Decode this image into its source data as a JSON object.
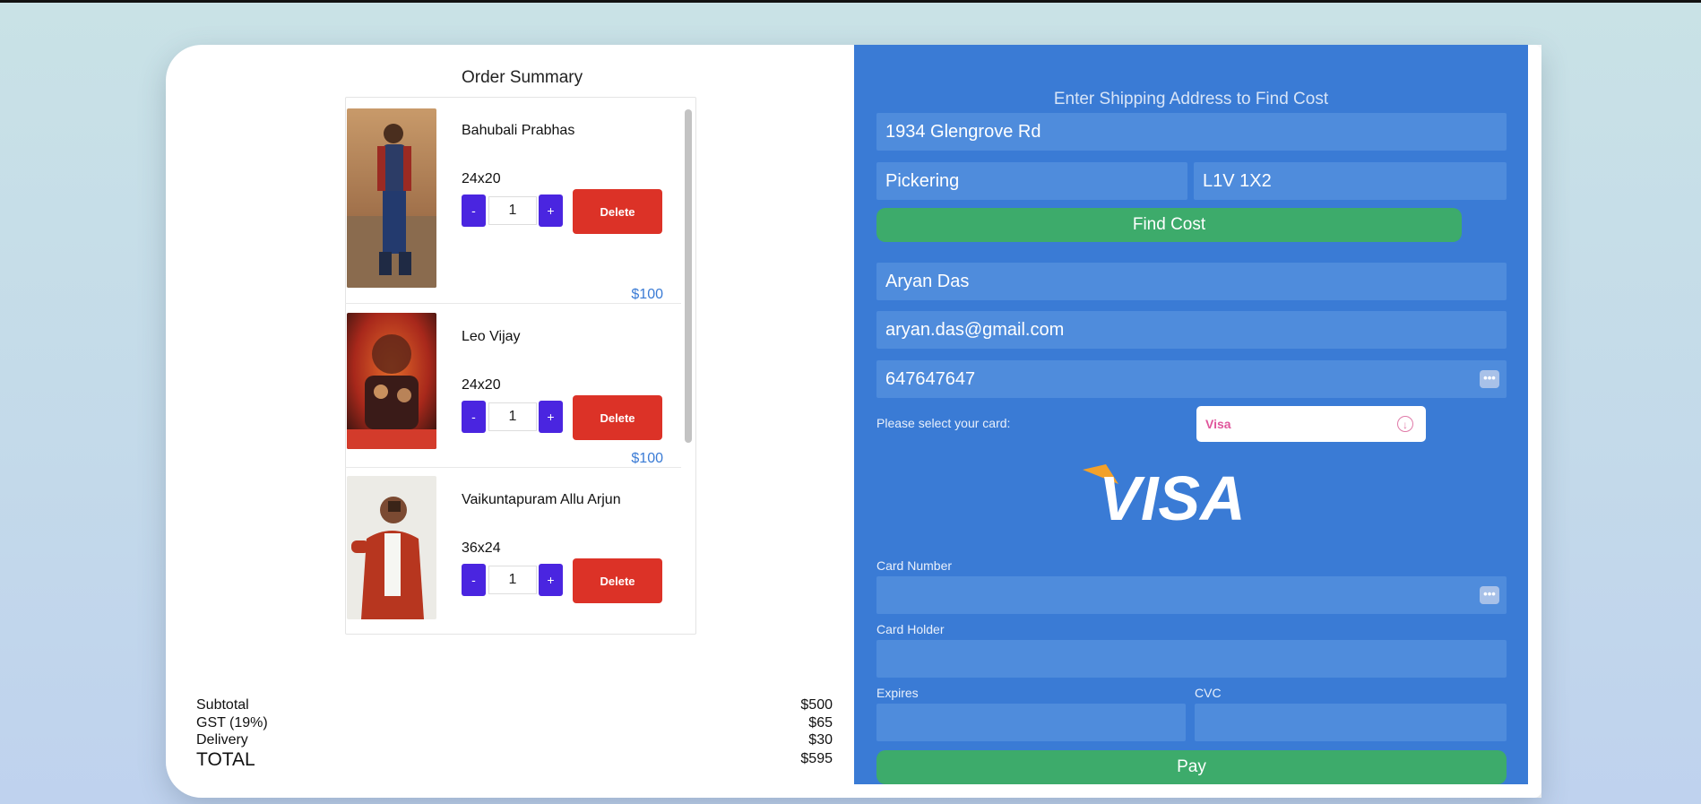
{
  "order": {
    "title": "Order Summary",
    "items": [
      {
        "name": "Bahubali Prabhas",
        "size": "24x20",
        "qty": "1",
        "delete_label": "Delete",
        "price": "$100"
      },
      {
        "name": "Leo Vijay",
        "size": "24x20",
        "qty": "1",
        "delete_label": "Delete",
        "price": "$100"
      },
      {
        "name": "Vaikuntapuram Allu Arjun",
        "size": "36x24",
        "qty": "1",
        "delete_label": "Delete",
        "price": ""
      }
    ],
    "minus_label": "-",
    "plus_label": "+"
  },
  "totals": {
    "subtotal_label": "Subtotal",
    "subtotal": "$500",
    "gst_label": "GST (19%)",
    "gst": "$65",
    "delivery_label": "Delivery",
    "delivery": "$30",
    "total_label": "TOTAL",
    "total": "$595"
  },
  "shipping": {
    "heading": "Enter Shipping Address to Find Cost",
    "street": "1934 Glengrove Rd",
    "city": "Pickering",
    "postal": "L1V 1X2",
    "find_cost_label": "Find Cost"
  },
  "contact": {
    "name": "Aryan Das",
    "email": "aryan.das@gmail.com",
    "phone": "647647647"
  },
  "payment": {
    "select_label": "Please select your card:",
    "card_type": "Visa",
    "logo_text": "VISA",
    "card_number_label": "Card Number",
    "card_holder_label": "Card Holder",
    "expires_label": "Expires",
    "cvc_label": "CVC",
    "pay_label": "Pay",
    "dots": "•••"
  },
  "colors": {
    "panel": "#3a7bd5",
    "accent_purple": "#4a25e0",
    "delete_red": "#dc3227",
    "green": "#3dab6b",
    "price_blue": "#3a7bd5"
  }
}
